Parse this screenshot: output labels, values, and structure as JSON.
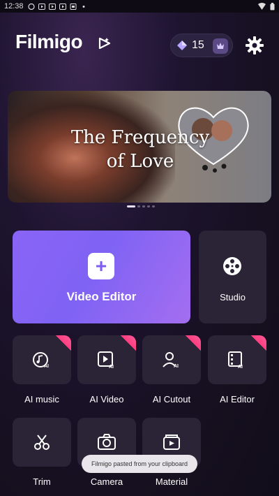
{
  "status_bar": {
    "time": "12:38"
  },
  "header": {
    "logo_text": "Filmigo",
    "credits": "15"
  },
  "banner": {
    "title_line1": "The Frequency",
    "title_line2": "of Love",
    "page_count": 5,
    "active_page": 1
  },
  "main_tiles": {
    "video_editor": "Video Editor",
    "studio": "Studio"
  },
  "features": [
    {
      "label": "AI music",
      "icon": "ai-music-icon",
      "badge": "New"
    },
    {
      "label": "AI Video",
      "icon": "ai-video-icon",
      "badge": "New"
    },
    {
      "label": "AI Cutout",
      "icon": "ai-cutout-icon",
      "badge": "New"
    },
    {
      "label": "AI Editor",
      "icon": "ai-editor-icon",
      "badge": "New"
    },
    {
      "label": "Trim",
      "icon": "scissors-icon"
    },
    {
      "label": "Camera",
      "icon": "camera-icon"
    },
    {
      "label": "Material",
      "icon": "material-icon"
    }
  ],
  "toast": {
    "text": "Filmigo pasted from your clipboard"
  },
  "colors": {
    "accent": "#8a64f6",
    "badge": "#ff3d7f",
    "tile": "#2a2436"
  }
}
